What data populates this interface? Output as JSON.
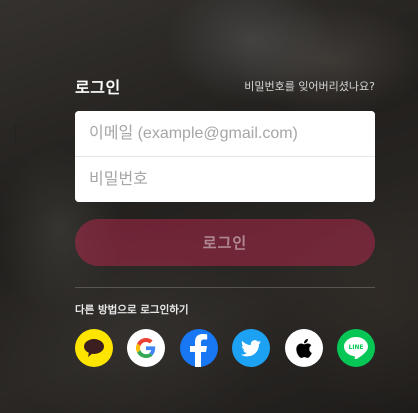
{
  "login": {
    "title": "로그인",
    "forgot_password_link": "비밀번호를 잊어버리셨나요?",
    "email_placeholder": "이메일 (example@gmail.com)",
    "email_value": "",
    "password_placeholder": "비밀번호",
    "password_value": "",
    "submit_label": "로그인",
    "alt_login_label": "다른 방법으로 로그인하기"
  },
  "social_providers": [
    {
      "name": "kakao",
      "icon": "kakao-speech-bubble-icon",
      "color": "#FEE500"
    },
    {
      "name": "google",
      "icon": "google-g-icon",
      "color": "#FFFFFF"
    },
    {
      "name": "facebook",
      "icon": "facebook-f-icon",
      "color": "#1877F2"
    },
    {
      "name": "twitter",
      "icon": "twitter-bird-icon",
      "color": "#1DA1F2"
    },
    {
      "name": "apple",
      "icon": "apple-logo-icon",
      "color": "#FFFFFF"
    },
    {
      "name": "line",
      "icon": "line-logo-icon",
      "color": "#06C755"
    }
  ],
  "colors": {
    "accent": "#C82850",
    "panel_text": "#FFFFFF"
  }
}
